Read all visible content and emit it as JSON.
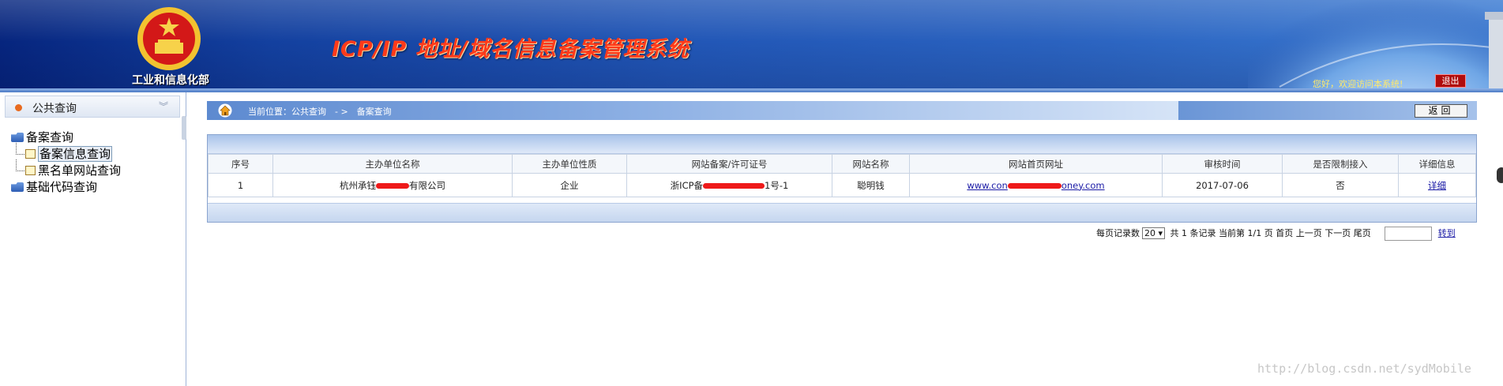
{
  "header": {
    "ministry": "工业和信息化部",
    "system_title": "ICP/IP 地址/域名信息备案管理系统",
    "welcome": "您好，欢迎访问本系统!",
    "exit_label": "退出",
    "accent": "#ff3a1a"
  },
  "sidebar": {
    "title": "公共查询",
    "collapse_icon": "chevron-double-down-icon",
    "tree": [
      {
        "label": "备案查询",
        "icon": "folder-icon",
        "children": [
          {
            "label": "备案信息查询",
            "icon": "page-icon",
            "selected": true
          },
          {
            "label": "黑名单网站查询",
            "icon": "page-icon",
            "selected": false
          }
        ]
      },
      {
        "label": "基础代码查询",
        "icon": "folder-icon",
        "children": []
      }
    ]
  },
  "breadcrumb": {
    "text": "当前位置：公共查询　- >　备案查询",
    "home_icon": "home-icon"
  },
  "back_label": "返回",
  "table": {
    "headers": [
      "序号",
      "主办单位名称",
      "主办单位性质",
      "网站备案/许可证号",
      "网站名称",
      "网站首页网址",
      "审核时间",
      "是否限制接入",
      "详细信息"
    ],
    "rows": [
      {
        "index": "1",
        "org_prefix": "杭州承钰",
        "org_suffix": "有限公司",
        "org_type": "企业",
        "license_prefix": "浙ICP备",
        "license_suffix": "1号-1",
        "site_name": "聪明钱",
        "url_prefix": "www.con",
        "url_suffix": "oney.com",
        "audit_date": "2017-07-06",
        "restricted": "否",
        "detail": "详细"
      }
    ]
  },
  "pager": {
    "per_page_label": "每页记录数",
    "per_page_value": "20",
    "total_text": "共 1 条记录",
    "current_text": "当前第 1/1 页",
    "first": "首页",
    "prev": "上一页",
    "next": "下一页",
    "last": "尾页",
    "goto": "转到"
  },
  "watermark": "http://blog.csdn.net/sydMobile"
}
